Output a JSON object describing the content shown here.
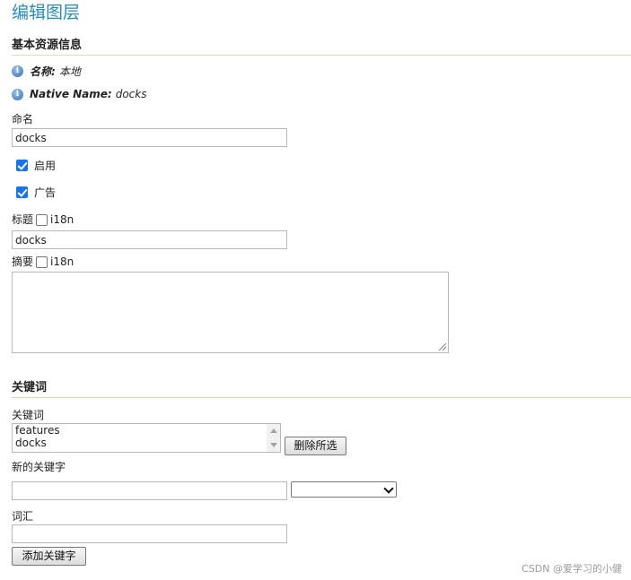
{
  "page": {
    "title": "编辑图层"
  },
  "basic_info": {
    "heading": "基本资源信息",
    "name_label": "名称:",
    "name_value": "本地",
    "native_label": "Native Name:",
    "native_value": "docks",
    "name_field_label": "命名",
    "name_field_value": "docks",
    "enabled_label": "启用",
    "enabled_checked": true,
    "advertised_label": "广告",
    "advertised_checked": true,
    "title_label": "标题",
    "title_i18n_label": "i18n",
    "title_value": "docks",
    "abstract_label": "摘要",
    "abstract_i18n_label": "i18n",
    "abstract_value": ""
  },
  "keywords": {
    "heading": "关键词",
    "list_label": "关键词",
    "items": [
      "features",
      "docks"
    ],
    "remove_button": "删除所选",
    "new_keyword_label": "新的关键字",
    "new_keyword_value": "",
    "language_selected": "",
    "vocabulary_label": "词汇",
    "vocabulary_value": "",
    "add_button": "添加关键字"
  },
  "watermark": "CSDN @爱学习的小健",
  "icons": {
    "info": "info-icon",
    "check": "checkmark-icon",
    "dropdown": "chevron-down-icon"
  }
}
